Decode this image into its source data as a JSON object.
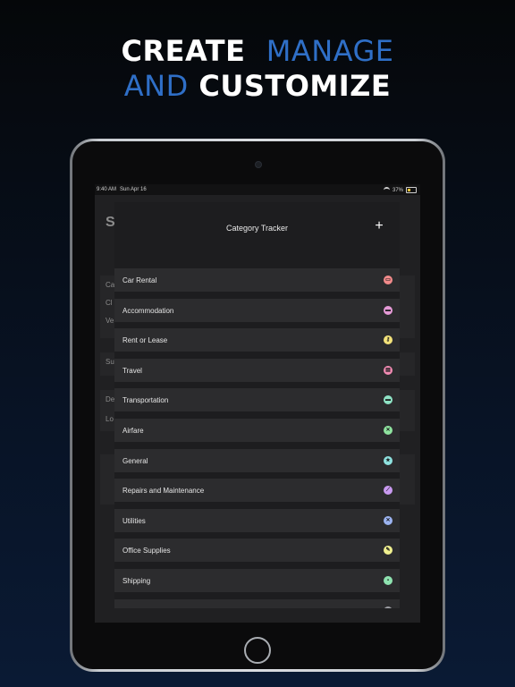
{
  "headline": {
    "line1_white": "CREATE",
    "line1_blue": "MANAGE",
    "line2_blue": "AND",
    "line2_white": "CUSTOMIZE"
  },
  "statusbar": {
    "time": "9:40 AM",
    "date": "Sun Apr 16",
    "battery": "37%"
  },
  "background_screen": {
    "title": "S",
    "rows": [
      "Ca",
      "Cl",
      "Ve",
      "Su",
      "De",
      "Lo"
    ]
  },
  "modal": {
    "title": "Category Tracker",
    "add_label": "+"
  },
  "categories": [
    {
      "label": "Car Rental",
      "icon": "car-icon",
      "color": "#f28b8b",
      "glyph": "▭"
    },
    {
      "label": "Accommodation",
      "icon": "bed-icon",
      "color": "#e59ad6",
      "glyph": "▬"
    },
    {
      "label": "Rent or Lease",
      "icon": "key-icon",
      "color": "#f3e27a",
      "glyph": "⚷"
    },
    {
      "label": "Travel",
      "icon": "briefcase-icon",
      "color": "#f28bb3",
      "glyph": "▤"
    },
    {
      "label": "Transportation",
      "icon": "bus-icon",
      "color": "#8fe3c5",
      "glyph": "▬"
    },
    {
      "label": "Airfare",
      "icon": "plane-icon",
      "color": "#8fe39f",
      "glyph": "✕"
    },
    {
      "label": "General",
      "icon": "star-icon",
      "color": "#8fe3e0",
      "glyph": "★"
    },
    {
      "label": "Repairs and Maintenance",
      "icon": "wrench-icon",
      "color": "#c99af0",
      "glyph": "⟋"
    },
    {
      "label": "Utilities",
      "icon": "tools-icon",
      "color": "#9bb3f0",
      "glyph": "✕"
    },
    {
      "label": "Office Supplies",
      "icon": "pencil-icon",
      "color": "#f0f08f",
      "glyph": "✎"
    },
    {
      "label": "Shipping",
      "icon": "truck-icon",
      "color": "#8fe3b0",
      "glyph": "▪"
    },
    {
      "label": "",
      "icon": "partial-icon",
      "color": "#9fa0a6",
      "glyph": ""
    }
  ]
}
